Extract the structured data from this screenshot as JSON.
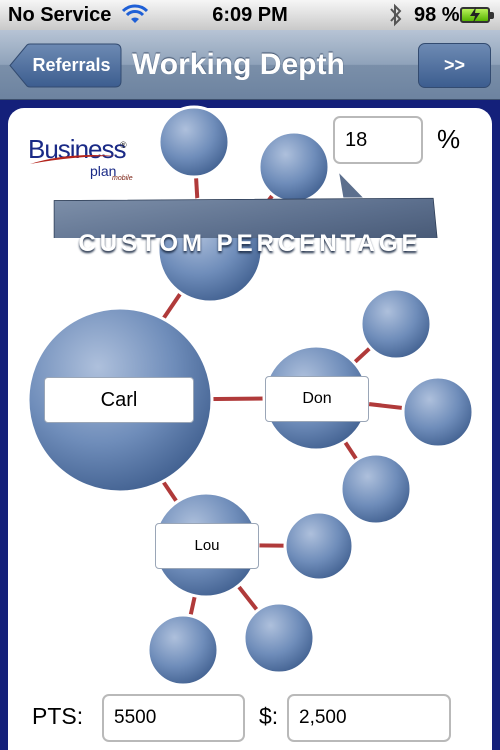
{
  "status_bar": {
    "carrier": "No Service",
    "time": "6:09 PM",
    "battery": "98 %",
    "icons": [
      "wifi-icon",
      "bluetooth-icon",
      "battery-charging-icon"
    ]
  },
  "nav": {
    "back_label": "Referrals",
    "title": "Working Depth",
    "forward_label": ">>"
  },
  "logo": {
    "brand": "Business",
    "plan": "plan",
    "mobile": "mobile",
    "reg": "®"
  },
  "percentage": {
    "value": "18",
    "sign": "%"
  },
  "banner": {
    "text": "CUSTOM PERCENTAGE"
  },
  "nodes": {
    "carl": "Carl",
    "don": "Don",
    "lou": "Lou"
  },
  "footer": {
    "pts_label": "PTS:",
    "pts_value": "5500",
    "usd_label": "$:",
    "usd_value": "2,500"
  },
  "colors": {
    "nav_top": "#b7c4d5",
    "bubble": "#5f7fae",
    "connector": "#b03a3a",
    "frame": "#14207a"
  }
}
